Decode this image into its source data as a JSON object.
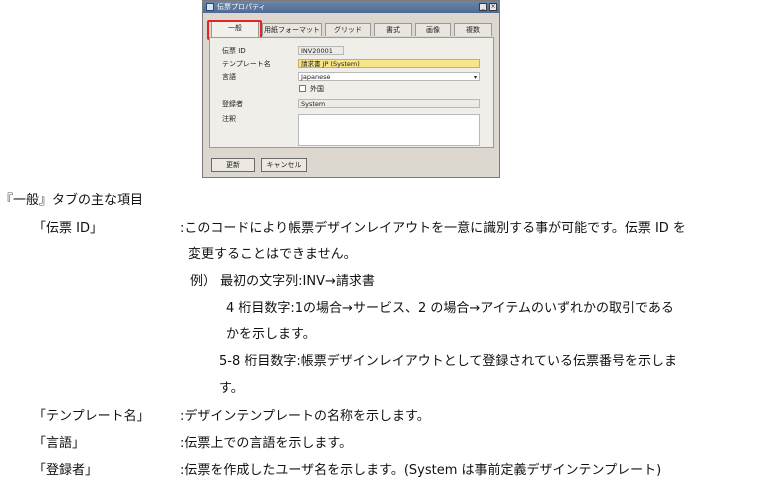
{
  "dialog": {
    "title": "伝票プロパティ",
    "tabs": [
      "一般",
      "用紙フォーマット",
      "グリッド",
      "書式",
      "画像",
      "複数"
    ],
    "active_tab": "一般",
    "fields": {
      "slip_id_label": "伝票 ID",
      "slip_id_value": "INV20001",
      "template_name_label": "テンプレート名",
      "template_name_value": "請求書 JP (System)",
      "language_label": "言語",
      "language_value": "Japanese",
      "foreign_label": "外国",
      "registrant_label": "登録者",
      "registrant_value": "System",
      "remarks_label": "注釈"
    },
    "buttons": {
      "update": "更新",
      "cancel": "キャンセル"
    }
  },
  "heading": "『一般』タブの主な項目",
  "items": [
    {
      "term": "「伝票 ID」",
      "desc": [
        ":このコードにより帳票デザインレイアウトを一意に識別する事が可能です。伝票 ID を",
        "変更することはできません。"
      ],
      "example": {
        "line1": "例） 最初の文字列:INV→請求書",
        "line2a": "4 桁目数字:1の場合→サービス、2 の場合→アイテムのいずれかの取引である",
        "line2b": "かを示します。",
        "line3a": "5-8  桁目数字:帳票デザインレイアウトとして登録されている伝票番号を示しま",
        "line3b": "す。"
      }
    },
    {
      "term": "「テンプレート名」",
      "desc": [
        ":デザインテンプレートの名称を示します。"
      ]
    },
    {
      "term": "「言語」",
      "desc": [
        ":伝票上での言語を示します。"
      ]
    },
    {
      "term": "「登録者」",
      "desc": [
        ":伝票を作成したユーザ名を示します。(System は事前定義デザインテンプレート)"
      ]
    }
  ],
  "colors": {
    "highlight": "#e3261f",
    "template_field": "#f8e58a",
    "titlebar": "#5a7499"
  }
}
